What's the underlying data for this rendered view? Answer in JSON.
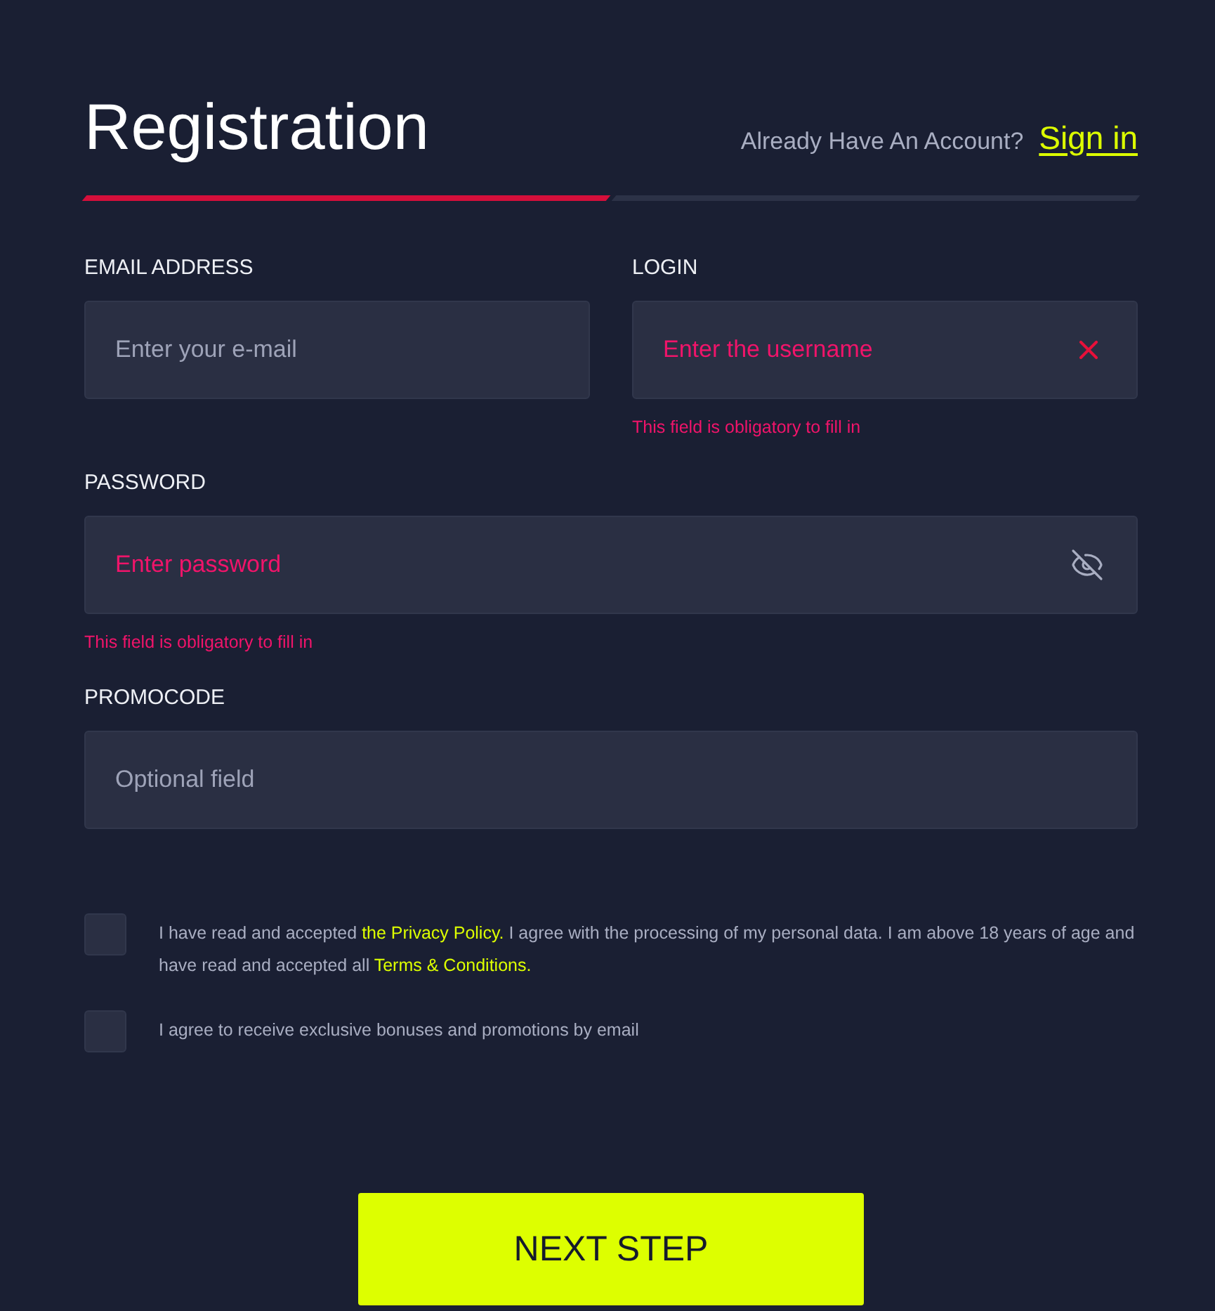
{
  "header": {
    "title": "Registration",
    "prompt": "Already Have An Account?",
    "sign_in_link": "Sign in"
  },
  "steps": [
    {
      "active": true
    },
    {
      "active": false
    }
  ],
  "form_rows": [
    {
      "fields": [
        {
          "label": "EMAIL ADDRESS",
          "kind": "email",
          "placeholder": "Enter your e-mail",
          "error": false
        },
        {
          "label": "LOGIN",
          "kind": "text",
          "placeholder": "Enter the username",
          "error": true,
          "error_message": "This field is obligatory to fill in"
        }
      ]
    },
    {
      "fields": [
        {
          "label": "PASSWORD",
          "kind": "password",
          "placeholder": "Enter password",
          "error": true,
          "error_message": "This field is obligatory to fill in"
        }
      ]
    },
    {
      "fields": [
        {
          "label": "PROMOCODE",
          "kind": "text",
          "placeholder": "Optional field",
          "error": false
        }
      ]
    }
  ],
  "consents": [
    {
      "checked": false,
      "parts": [
        {
          "kind": "text",
          "text": "I have read and accepted "
        },
        {
          "kind": "link",
          "text": "the Privacy Policy."
        },
        {
          "kind": "text",
          "text": " I agree with the processing of my personal data. I am above 18 years of age and have read and accepted all "
        },
        {
          "kind": "link",
          "text": "Terms & Conditions."
        }
      ]
    },
    {
      "checked": false,
      "parts": [
        {
          "kind": "text",
          "text": "I agree to receive exclusive bonuses and promotions by email"
        }
      ]
    }
  ],
  "submit_button": "NEXT STEP"
}
